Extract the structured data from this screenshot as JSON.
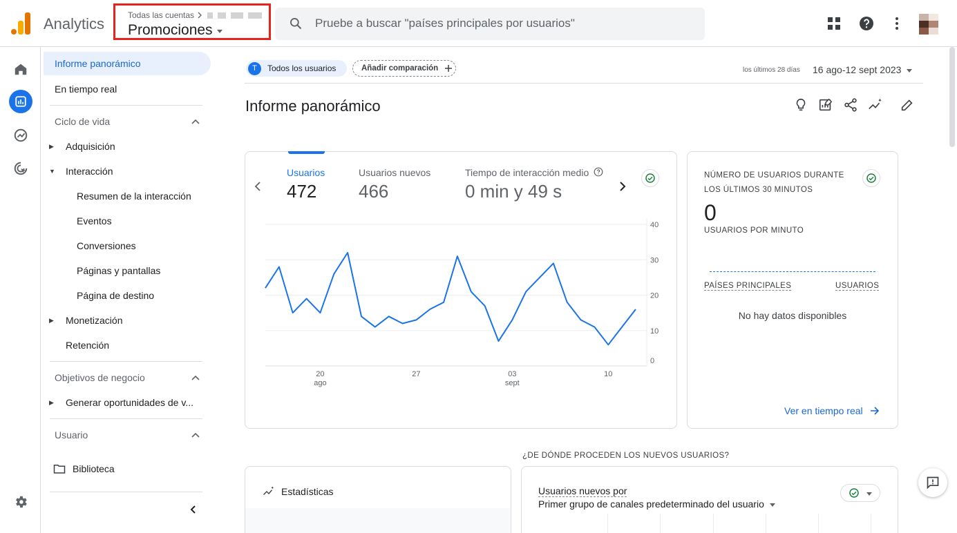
{
  "app": {
    "name": "Analytics"
  },
  "account": {
    "crumb": "Todas las cuentas",
    "property": "Promociones"
  },
  "search": {
    "placeholder": "Pruebe a buscar \"países principales por usuarios\""
  },
  "nav": {
    "home": "Informe panorámico",
    "realtime": "En tiempo real",
    "lifecycle": "Ciclo de vida",
    "acquisition": "Adquisición",
    "engagement": "Interacción",
    "eng_items": [
      "Resumen de la interacción",
      "Eventos",
      "Conversiones",
      "Páginas y pantallas",
      "Página de destino"
    ],
    "monetization": "Monetización",
    "retention": "Retención",
    "business": "Objetivos de negocio",
    "leads": "Generar oportunidades de v...",
    "user": "Usuario",
    "library": "Biblioteca"
  },
  "filters": {
    "users_chip_initial": "T",
    "users_chip": "Todos los usuarios",
    "add_comparison": "Añadir comparación",
    "range_label": "los últimos 28 días",
    "range": "16 ago-12 sept 2023"
  },
  "report": {
    "title": "Informe panorámico"
  },
  "metrics": [
    {
      "label": "Usuarios",
      "value": "472"
    },
    {
      "label": "Usuarios nuevos",
      "value": "466"
    },
    {
      "label": "Tiempo de interacción medio",
      "value": "0 min y 49 s"
    }
  ],
  "chart_data": {
    "type": "line",
    "series": [
      {
        "values": [
          22,
          28,
          15,
          19,
          15,
          26,
          32,
          14,
          11,
          14,
          12,
          13,
          16,
          18,
          31,
          21,
          17,
          7,
          13,
          21,
          25,
          29,
          18,
          13,
          11,
          6,
          11,
          16
        ]
      }
    ],
    "x_ticks": [
      {
        "day": "20",
        "month": "ago"
      },
      {
        "day": "27",
        "month": ""
      },
      {
        "day": "03",
        "month": "sept"
      },
      {
        "day": "10",
        "month": ""
      }
    ],
    "y_ticks": [
      "40",
      "30",
      "20",
      "10",
      "0"
    ],
    "ylim": [
      0,
      40
    ],
    "grid": true,
    "line_color": "#1a73e8"
  },
  "realtime": {
    "title": "NÚMERO DE USUARIOS DURANTE LOS ÚLTIMOS 30 MINUTOS",
    "value": "0",
    "per_minute": "USUARIOS POR MINUTO",
    "col_country": "PAÍSES PRINCIPALES",
    "col_users": "USUARIOS",
    "empty": "No hay datos disponibles",
    "link": "Ver en tiempo real"
  },
  "bottom": {
    "heading": "¿DE DÓNDE PROCEDEN LOS NUEVOS USUARIOS?",
    "insights": "Estadísticas",
    "new_users_by": "Usuarios nuevos por",
    "dimension": "Primer grupo de canales predeterminado del usuario"
  },
  "colors": {
    "accent": "#1a73e8",
    "highlight_border": "#e8231b",
    "logo_orange": "#f9ab00",
    "logo_dark": "#e37400"
  }
}
